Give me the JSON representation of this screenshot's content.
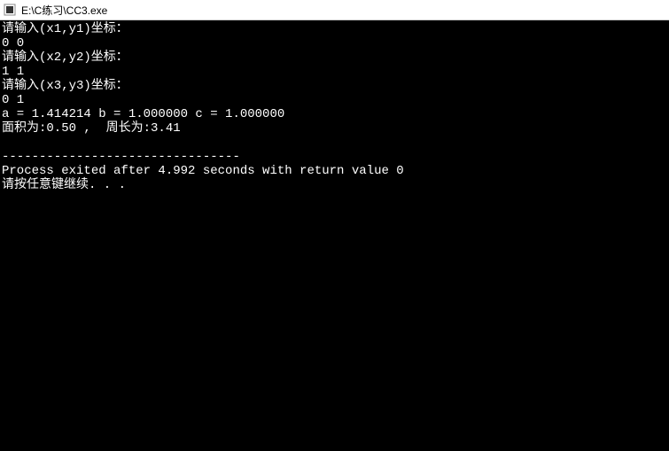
{
  "window": {
    "title": "E:\\C练习\\CC3.exe"
  },
  "console": {
    "lines": {
      "l0": "请输入(x1,y1)坐标：",
      "l1": "0 0",
      "l2": "请输入(x2,y2)坐标：",
      "l3": "1 1",
      "l4": "请输入(x3,y3)坐标：",
      "l5": "0 1",
      "l6": "a = 1.414214 b = 1.000000 c = 1.000000",
      "l7": "面积为:0.50 ,  周长为:3.41",
      "l8": "",
      "l9": "--------------------------------",
      "l10": "Process exited after 4.992 seconds with return value 0",
      "l11": "请按任意键继续. . ."
    }
  }
}
